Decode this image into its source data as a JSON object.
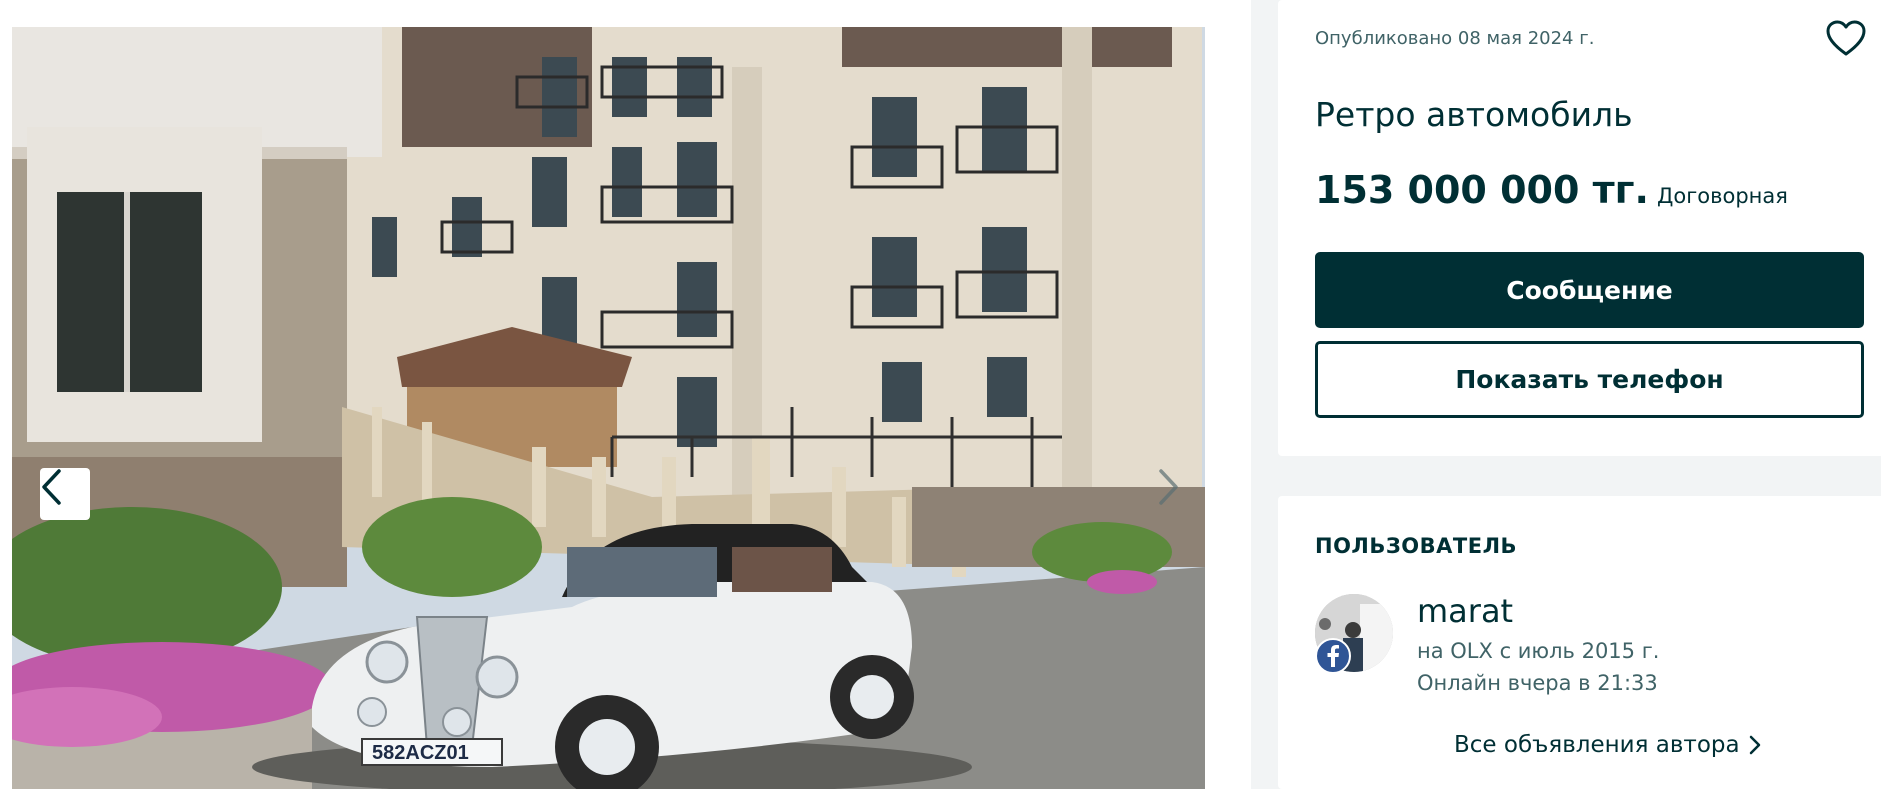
{
  "gallery": {
    "photo_alt": "Ретро автомобиль",
    "plate": "582ACZ01",
    "prev_icon": "chevron-left-icon",
    "next_icon": "chevron-right-icon"
  },
  "offer": {
    "published": "Опубликовано 08 мая 2024 г.",
    "favorite_icon": "heart-outline-icon",
    "title": "Ретро автомобиль",
    "price": "153 000 000 тг.",
    "negotiable": "Договорная",
    "message_button": "Сообщение",
    "phone_button": "Показать телефон"
  },
  "user": {
    "heading": "ПОЛЬЗОВАТЕЛЬ",
    "name": "marat",
    "since": "на OLX с июль 2015 г.",
    "online": "Онлайн вчера в 21:33",
    "all_ads_link": "Все объявления автора",
    "badge_icon": "facebook-icon",
    "link_icon": "chevron-right-icon"
  },
  "colors": {
    "primary": "#002f34",
    "muted": "#406367",
    "background": "#f2f4f5",
    "facebook": "#2f5596"
  }
}
